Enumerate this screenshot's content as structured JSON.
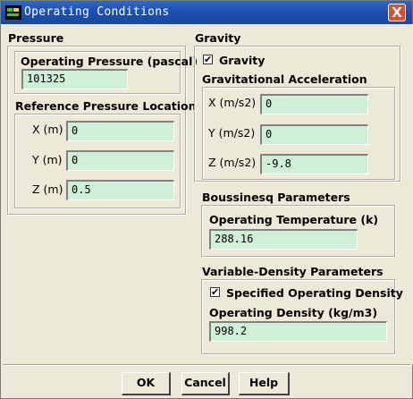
{
  "window": {
    "title": "Operating Conditions",
    "close_glyph": "X"
  },
  "pressure": {
    "heading": "Pressure",
    "operating_pressure_label": "Operating Pressure (pascal)",
    "operating_pressure_value": "101325",
    "ref_location_label": "Reference Pressure Location",
    "x_label": "X (m)",
    "x_value": "0",
    "y_label": "Y (m)",
    "y_value": "0",
    "z_label": "Z (m)",
    "z_value": "0.5"
  },
  "gravity": {
    "heading": "Gravity",
    "checkbox_label": "Gravity",
    "checked": true,
    "accel_label": "Gravitational Acceleration",
    "x_label": "X (m/s2)",
    "x_value": "0",
    "y_label": "Y (m/s2)",
    "y_value": "0",
    "z_label": "Z (m/s2)",
    "z_value": "-9.8"
  },
  "boussinesq": {
    "heading": "Boussinesq Parameters",
    "op_temp_label": "Operating Temperature (k)",
    "op_temp_value": "288.16"
  },
  "variable_density": {
    "heading": "Variable-Density Parameters",
    "checkbox_label": "Specified Operating Density",
    "checked": true,
    "op_density_label": "Operating Density (kg/m3)",
    "op_density_value": "998.2"
  },
  "buttons": {
    "ok": "OK",
    "cancel": "Cancel",
    "help": "Help"
  },
  "icons": {
    "title": "fluent-app-icon",
    "check_mark": "✔"
  },
  "colors": {
    "titlebar": "#1e50b0",
    "field_bg": "#cff0d6",
    "dialog_bg": "#ece9d8",
    "close_bg": "#d9522d"
  }
}
